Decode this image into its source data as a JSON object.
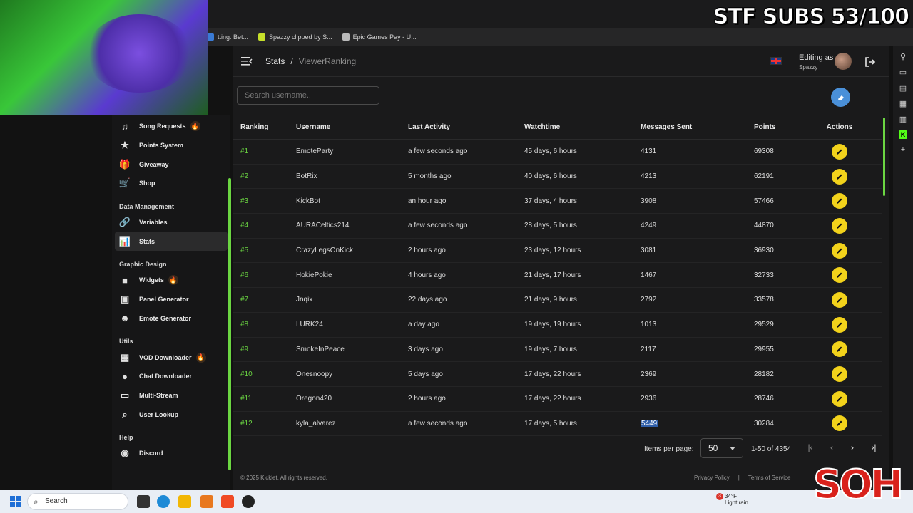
{
  "overlay": {
    "subs_text": "STF SUBS 53/100",
    "watermark_text": "SOH"
  },
  "bookmarks": [
    {
      "label": "tting: Bet...",
      "color": "#3a7bd5"
    },
    {
      "label": "Spazzy clipped by S...",
      "color": "#c6e02a"
    },
    {
      "label": "Epic Games Pay - U...",
      "color": "#bbbbbb"
    }
  ],
  "sidebar": {
    "items_top": [
      {
        "label": "Song Requests",
        "icon": "music-note-icon",
        "glyph": "♫",
        "hot": true
      },
      {
        "label": "Points System",
        "icon": "star-icon",
        "glyph": "★",
        "hot": false
      },
      {
        "label": "Giveaway",
        "icon": "gift-icon",
        "glyph": "🎁",
        "hot": false
      },
      {
        "label": "Shop",
        "icon": "cart-icon",
        "glyph": "🛒",
        "hot": false
      }
    ],
    "section_data": "Data Management",
    "items_data": [
      {
        "label": "Variables",
        "icon": "link-icon",
        "glyph": "🔗",
        "hot": false,
        "active": false
      },
      {
        "label": "Stats",
        "icon": "bar-chart-icon",
        "glyph": "📊",
        "hot": false,
        "active": true
      }
    ],
    "section_graphic": "Graphic Design",
    "items_graphic": [
      {
        "label": "Widgets",
        "icon": "camera-icon",
        "glyph": "■",
        "hot": true
      },
      {
        "label": "Panel Generator",
        "icon": "panel-icon",
        "glyph": "▣",
        "hot": false
      },
      {
        "label": "Emote Generator",
        "icon": "smile-icon",
        "glyph": "☻",
        "hot": false
      }
    ],
    "section_utils": "Utils",
    "items_utils": [
      {
        "label": "VOD Downloader",
        "icon": "film-icon",
        "glyph": "▦",
        "hot": true
      },
      {
        "label": "Chat Downloader",
        "icon": "chat-icon",
        "glyph": "●",
        "hot": false
      },
      {
        "label": "Multi-Stream",
        "icon": "monitor-icon",
        "glyph": "▭",
        "hot": false
      },
      {
        "label": "User Lookup",
        "icon": "search-icon",
        "glyph": "⌕",
        "hot": false
      }
    ],
    "section_help": "Help",
    "items_help": [
      {
        "label": "Discord",
        "icon": "discord-icon",
        "glyph": "◉",
        "hot": false
      }
    ]
  },
  "header": {
    "breadcrumb_root": "Stats",
    "breadcrumb_sep": "/",
    "breadcrumb_current": "ViewerRanking",
    "editing_label": "Editing as",
    "editing_user": "Spazzy"
  },
  "search": {
    "placeholder": "Search username.."
  },
  "table": {
    "columns": [
      "Ranking",
      "Username",
      "Last Activity",
      "Watchtime",
      "Messages Sent",
      "Points",
      "Actions"
    ],
    "rows": [
      {
        "rank": "#1",
        "user": "EmoteParty",
        "activity": "a few seconds ago",
        "watch": "45 days, 6 hours",
        "msgs": "4131",
        "points": "69308"
      },
      {
        "rank": "#2",
        "user": "BotRix",
        "activity": "5 months ago",
        "watch": "40 days, 6 hours",
        "msgs": "4213",
        "points": "62191"
      },
      {
        "rank": "#3",
        "user": "KickBot",
        "activity": "an hour ago",
        "watch": "37 days, 4 hours",
        "msgs": "3908",
        "points": "57466"
      },
      {
        "rank": "#4",
        "user": "AURACeltics214",
        "activity": "a few seconds ago",
        "watch": "28 days, 5 hours",
        "msgs": "4249",
        "points": "44870"
      },
      {
        "rank": "#5",
        "user": "CrazyLegsOnKick",
        "activity": "2 hours ago",
        "watch": "23 days, 12 hours",
        "msgs": "3081",
        "points": "36930"
      },
      {
        "rank": "#6",
        "user": "HokiePokie",
        "activity": "4 hours ago",
        "watch": "21 days, 17 hours",
        "msgs": "1467",
        "points": "32733"
      },
      {
        "rank": "#7",
        "user": "Jnqix",
        "activity": "22 days ago",
        "watch": "21 days, 9 hours",
        "msgs": "2792",
        "points": "33578"
      },
      {
        "rank": "#8",
        "user": "LURK24",
        "activity": "a day ago",
        "watch": "19 days, 19 hours",
        "msgs": "1013",
        "points": "29529"
      },
      {
        "rank": "#9",
        "user": "SmokeInPeace",
        "activity": "3 days ago",
        "watch": "19 days, 7 hours",
        "msgs": "2117",
        "points": "29955"
      },
      {
        "rank": "#10",
        "user": "Onesnoopy",
        "activity": "5 days ago",
        "watch": "17 days, 22 hours",
        "msgs": "2369",
        "points": "28182"
      },
      {
        "rank": "#11",
        "user": "Oregon420",
        "activity": "2 hours ago",
        "watch": "17 days, 22 hours",
        "msgs": "2936",
        "points": "28746"
      },
      {
        "rank": "#12",
        "user": "kyla_alvarez",
        "activity": "a few seconds ago",
        "watch": "17 days, 5 hours",
        "msgs": "5449",
        "points": "30284"
      }
    ],
    "highlighted_row": 11
  },
  "pagination": {
    "items_per_page_label": "Items per page:",
    "items_per_page_value": "50",
    "range": "1-50 of 4354"
  },
  "footer": {
    "copyright": "© 2025 Kicklet. All rights reserved.",
    "privacy": "Privacy Policy",
    "sep": "|",
    "terms": "Terms of Service"
  },
  "taskbar": {
    "search_label": "Search",
    "weather_temp": "34°F",
    "weather_desc": "Light rain",
    "weather_badge": "3"
  },
  "colors": {
    "accent_green": "#6bd642",
    "edit_yellow": "#f2d21b",
    "eraser_blue": "#4a90d9",
    "highlight_blue": "#2f5ea8"
  }
}
